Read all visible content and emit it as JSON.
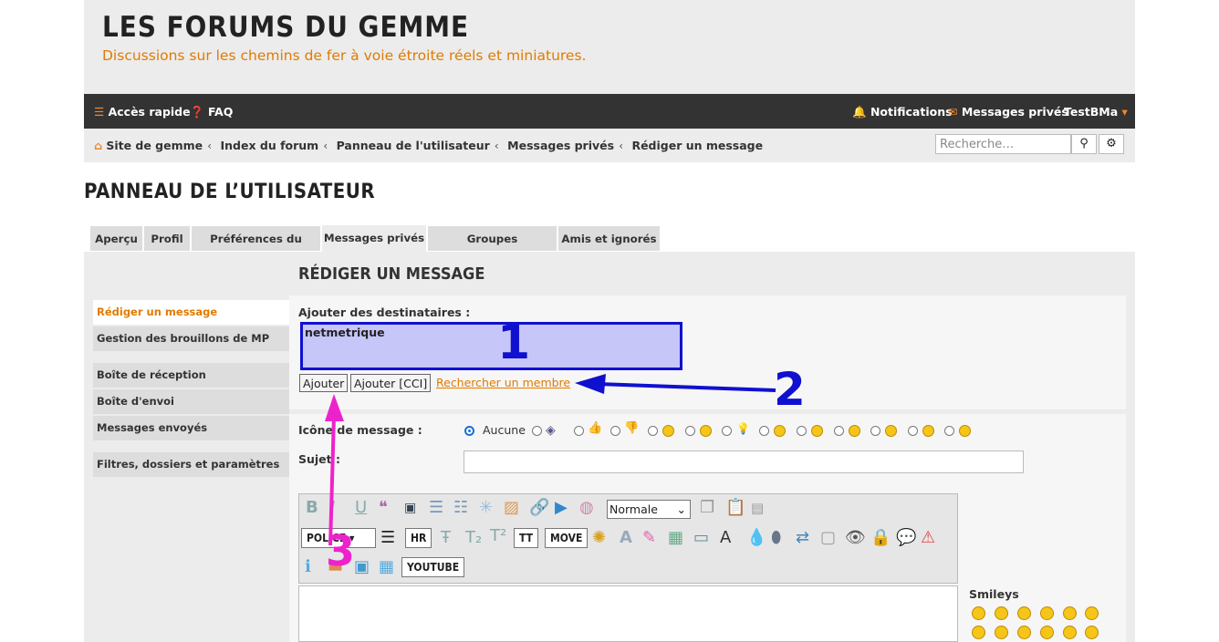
{
  "header": {
    "title": "LES FORUMS DU GEMME",
    "description": "Discussions sur les chemins de fer à voie étroite réels et miniatures."
  },
  "navbar": {
    "quick_access": "Accès rapide",
    "faq": "FAQ",
    "notifications": "Notifications",
    "private_messages": "Messages privés",
    "username": "TestBMa"
  },
  "breadcrumbs": [
    "Site de gemme",
    "Index du forum",
    "Panneau de l'utilisateur",
    "Messages privés",
    "Rédiger un message"
  ],
  "search": {
    "placeholder": "Recherche…"
  },
  "page_title": "PANNEAU DE L’UTILISATEUR",
  "tabs": [
    "Aperçu",
    "Profil",
    "Préférences du forum",
    "Messages privés",
    "Groupes d'utilisateurs",
    "Amis et ignorés"
  ],
  "active_tab": "Messages privés",
  "sidebar": {
    "group1": [
      "Rédiger un message",
      "Gestion des brouillons de MP"
    ],
    "group2": [
      "Boîte de réception",
      "Boîte d'envoi",
      "Messages envoyés"
    ],
    "group3": [
      "Filtres, dossiers et paramètres"
    ]
  },
  "section_title": "RÉDIGER UN MESSAGE",
  "form": {
    "recipients_label": "Ajouter des destinataires :",
    "recipients_value": "netmetrique",
    "add_button": "Ajouter",
    "add_bcc_button": "Ajouter [CCI]",
    "find_member_link": "Rechercher un membre",
    "icon_label": "Icône de message :",
    "icon_none": "Aucune",
    "subject_label": "Sujet :",
    "font_size_select": "Normale",
    "font_button": "POLICE",
    "hr_button": "HR",
    "tt_button": "TT",
    "move_button": "MOVE",
    "youtube_button": "YOUTUBE",
    "smileys_label": "Smileys"
  },
  "annotations": {
    "one": "1",
    "two": "2",
    "three": "3"
  },
  "colors": {
    "accent": "#e07b00",
    "navbar": "#333333",
    "annotation_blue": "#1010d0",
    "annotation_magenta": "#ee22cc"
  }
}
